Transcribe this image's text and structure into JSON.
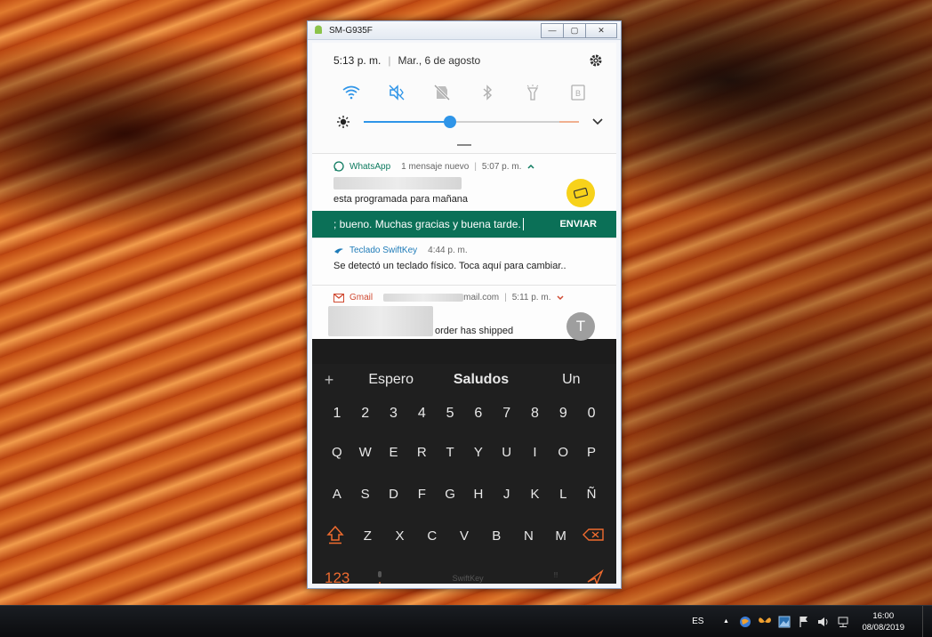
{
  "window": {
    "title": "SM-G935F",
    "minimize": "—",
    "maximize": "▢",
    "close": "✕"
  },
  "quick_panel": {
    "time": "5:13 p. m.",
    "date": "Mar., 6 de agosto",
    "toggles": [
      "wifi-icon",
      "mute-vibrate-icon",
      "location-off-icon",
      "bluetooth-icon",
      "flashlight-icon",
      "b-icon"
    ],
    "brightness_level": 0.4
  },
  "notifications": {
    "whatsapp": {
      "app": "WhatsApp",
      "summary": "1 mensaje nuevo",
      "time": "5:07 p. m.",
      "message": "esta programada para mañana",
      "reply_text": "; bueno. Muchas gracias y buena tarde.",
      "send_label": "ENVIAR"
    },
    "swiftkey": {
      "app": "Teclado SwiftKey",
      "time": "4:44 p. m.",
      "message": "Se detectó un teclado físico. Toca aquí para cambiar.."
    },
    "gmail": {
      "app": "Gmail",
      "account_suffix": "mail.com",
      "time": "5:11 p. m.",
      "message": "order has shipped",
      "avatar_letter": "T"
    }
  },
  "keyboard": {
    "plus": "+",
    "suggestions": [
      "Espero",
      "Saludos",
      "Un"
    ],
    "number_row": [
      "1",
      "2",
      "3",
      "4",
      "5",
      "6",
      "7",
      "8",
      "9",
      "0"
    ],
    "row1": [
      "Q",
      "W",
      "E",
      "R",
      "T",
      "Y",
      "U",
      "I",
      "O",
      "P"
    ],
    "row2": [
      "A",
      "S",
      "D",
      "F",
      "G",
      "H",
      "J",
      "K",
      "L",
      "Ñ"
    ],
    "row3": [
      "Z",
      "X",
      "C",
      "V",
      "B",
      "N",
      "M"
    ],
    "mode_key": "123",
    "brand": "SwiftKey"
  },
  "taskbar": {
    "language": "ES",
    "time": "16:00",
    "date": "08/08/2019",
    "tray_up_arrow": "▲"
  }
}
